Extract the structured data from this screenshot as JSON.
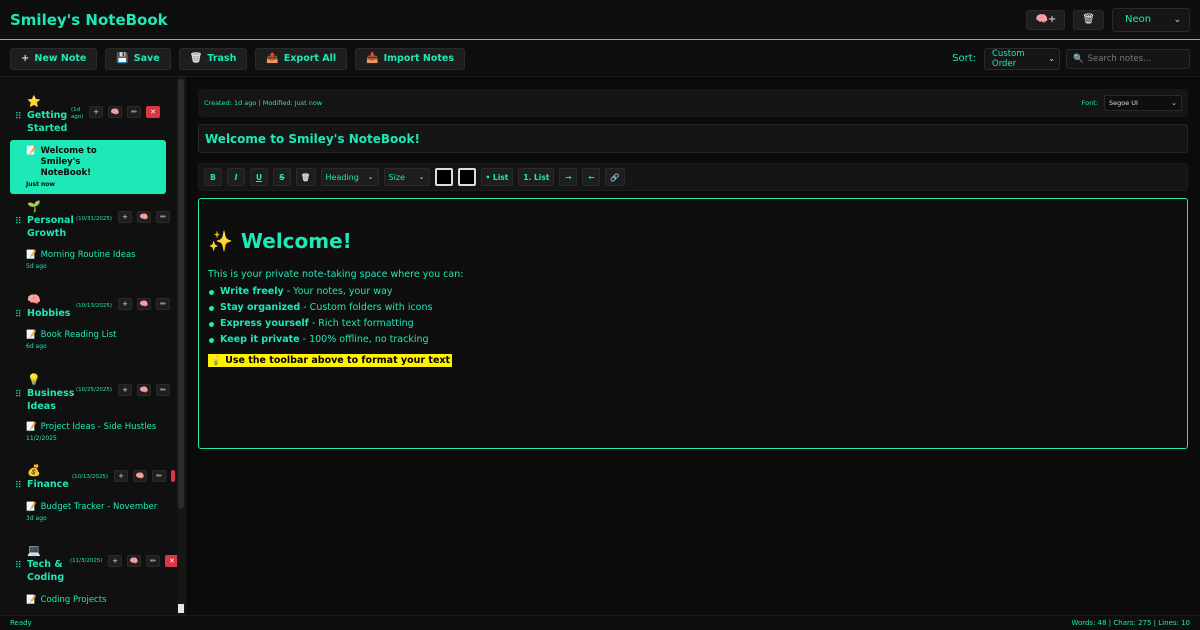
{
  "app": {
    "title": "Smiley's NoteBook"
  },
  "header": {
    "add_folder_label": "🧠+",
    "trash_icon_label": "🗑",
    "theme_value": "Neon"
  },
  "toolbar": {
    "new_note": "New Note",
    "save": "Save",
    "trash": "Trash",
    "export_all": "Export All",
    "import_notes": "Import Notes",
    "sort_label": "Sort:",
    "sort_value": "Custom Order",
    "search_placeholder": "Search notes..."
  },
  "sidebar": {
    "folders": [
      {
        "emoji": "⭐",
        "name": "Getting Started",
        "date": "(1d ago)",
        "notes": [
          {
            "title": "Welcome to Smiley's NoteBook!",
            "time": "Just now",
            "active": true
          }
        ]
      },
      {
        "emoji": "🌱",
        "name": "Personal Growth",
        "date": "(10/31/2025)",
        "notes": [
          {
            "title": "Morning Routine Ideas",
            "time": "5d ago"
          }
        ]
      },
      {
        "emoji": "🧠",
        "name": "Hobbies",
        "date": "(10/13/2025)",
        "notes": [
          {
            "title": "Book Reading List",
            "time": "6d ago"
          }
        ]
      },
      {
        "emoji": "💡",
        "name": "Business Ideas",
        "date": "(10/25/2025)",
        "notes": [
          {
            "title": "Project Ideas - Side Hustles",
            "time": "11/2/2025"
          }
        ]
      },
      {
        "emoji": "💰",
        "name": "Finance",
        "date": "(10/13/2025)",
        "notes": [
          {
            "title": "Budget Tracker - November",
            "time": "3d ago"
          }
        ]
      },
      {
        "emoji": "💻",
        "name": "Tech & Coding",
        "date": "(11/3/2025)",
        "notes": [
          {
            "title": "Coding Projects",
            "time": ""
          }
        ]
      }
    ]
  },
  "editor": {
    "meta": "Created: 1d ago | Modified: Just now",
    "font_label": "Font:",
    "font_value": "Segoe UI",
    "title": "Welcome to Smiley's NoteBook!",
    "format": {
      "bold": "B",
      "italic": "I",
      "underline": "U",
      "strike": "S",
      "heading": "Heading",
      "size": "Size",
      "bullet_list": "• List",
      "numbered_list": "1. List",
      "indent": "→",
      "outdent": "←"
    },
    "content": {
      "heading_emoji": "✨",
      "heading": "Welcome!",
      "intro": "This is your private note-taking space where you can:",
      "items": [
        {
          "bold": "Write freely",
          "rest": " - Your notes, your way"
        },
        {
          "bold": "Stay organized",
          "rest": " - Custom folders with icons"
        },
        {
          "bold": "Express yourself",
          "rest": " - Rich text formatting"
        },
        {
          "bold": "Keep it private",
          "rest": " - 100% offline, no tracking"
        }
      ],
      "tip": "💡 Use the toolbar above to format your text"
    }
  },
  "status": {
    "left": "Ready",
    "right": "Words: 48 | Chars: 275 | Lines: 10"
  },
  "colors": {
    "accent": "#1de9b6",
    "background": "#0b0b0b",
    "danger": "#dc3545",
    "highlight": "#fff200"
  }
}
